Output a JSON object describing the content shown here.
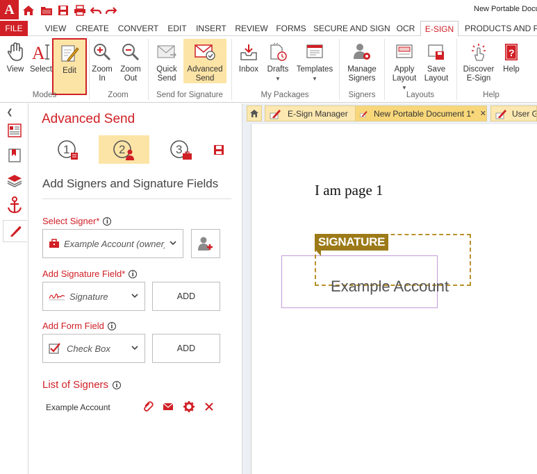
{
  "window": {
    "title": "New Portable Docu"
  },
  "menu": {
    "tabs": [
      "FILE",
      "VIEW",
      "CREATE",
      "CONVERT",
      "EDIT",
      "INSERT",
      "REVIEW",
      "FORMS",
      "SECURE AND SIGN",
      "OCR",
      "E-SIGN",
      "PRODUCTS AND PR"
    ],
    "active": "E-SIGN"
  },
  "ribbon": {
    "view": "View",
    "select": "Select",
    "edit": "Edit",
    "zoom_in_1": "Zoom",
    "zoom_in_2": "In",
    "zoom_out_1": "Zoom",
    "zoom_out_2": "Out",
    "quick_send_1": "Quick",
    "quick_send_2": "Send",
    "advanced_send_1": "Advanced",
    "advanced_send_2": "Send",
    "inbox": "Inbox",
    "drafts": "Drafts",
    "templates": "Templates",
    "manage_signers_1": "Manage",
    "manage_signers_2": "Signers",
    "apply_layout_1": "Apply",
    "apply_layout_2": "Layout",
    "save_layout_1": "Save",
    "save_layout_2": "Layout",
    "discover_1": "Discover",
    "discover_2": "E-Sign",
    "help": "Help",
    "groups": {
      "modes": "Modes",
      "zoom": "Zoom",
      "send": "Send for Signature",
      "packages": "My Packages",
      "signers": "Signers",
      "layouts": "Layouts",
      "help": "Help"
    }
  },
  "panel": {
    "title": "Advanced Send",
    "steps": [
      "1",
      "2",
      "3"
    ],
    "section_title": "Add Signers and Signature Fields",
    "select_signer_label": "Select Signer",
    "select_signer_value": "Example Account (owner)",
    "add_sig_label": "Add Signature Field",
    "add_sig_value": "Signature",
    "add_sig_button": "ADD",
    "add_form_label": "Add Form Field",
    "add_form_value": "Check Box",
    "add_form_button": "ADD",
    "list_title": "List of Signers",
    "signers": [
      {
        "name": "Example Account"
      }
    ]
  },
  "doc": {
    "tabs": [
      {
        "label": "E-Sign Manager"
      },
      {
        "label": "New Portable Document 1*"
      },
      {
        "label": "User Gu"
      }
    ],
    "page_text": "I am page 1",
    "signature_label": "SIGNATURE",
    "signature_name": "Example Account"
  },
  "colors": {
    "accent": "#d01f25",
    "highlight": "#fce4a6",
    "signature": "#9c7a17"
  }
}
